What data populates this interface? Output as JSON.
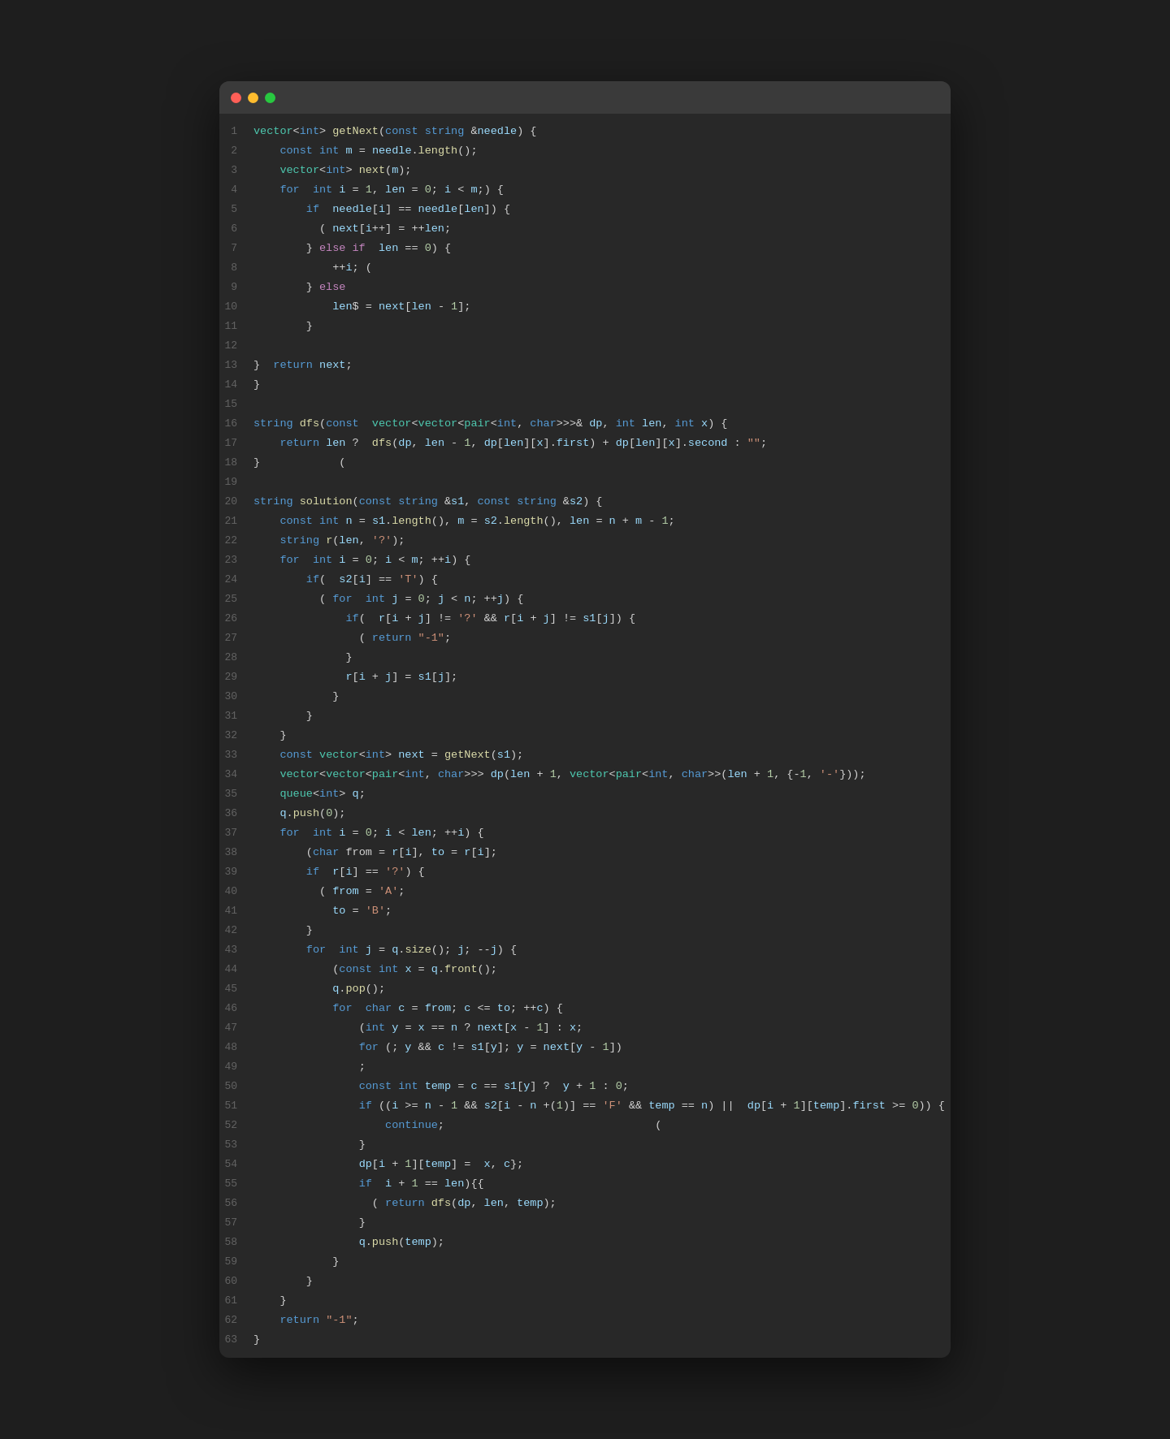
{
  "window": {
    "titlebar": {
      "dot_red": "close",
      "dot_yellow": "minimize",
      "dot_green": "maximize"
    }
  },
  "code": {
    "lines": [
      {
        "n": 1
      },
      {
        "n": 2
      },
      {
        "n": 3
      },
      {
        "n": 4
      },
      {
        "n": 5
      },
      {
        "n": 6
      },
      {
        "n": 7
      },
      {
        "n": 8
      },
      {
        "n": 9
      },
      {
        "n": 10
      },
      {
        "n": 11
      },
      {
        "n": 12
      },
      {
        "n": 13
      },
      {
        "n": 14
      },
      {
        "n": 15
      },
      {
        "n": 16
      },
      {
        "n": 17
      },
      {
        "n": 18
      },
      {
        "n": 19
      },
      {
        "n": 20
      },
      {
        "n": 21
      },
      {
        "n": 22
      },
      {
        "n": 23
      },
      {
        "n": 24
      },
      {
        "n": 25
      },
      {
        "n": 26
      },
      {
        "n": 27
      },
      {
        "n": 28
      },
      {
        "n": 29
      },
      {
        "n": 30
      },
      {
        "n": 31
      },
      {
        "n": 32
      },
      {
        "n": 33
      },
      {
        "n": 34
      },
      {
        "n": 35
      },
      {
        "n": 36
      },
      {
        "n": 37
      },
      {
        "n": 38
      },
      {
        "n": 39
      },
      {
        "n": 40
      },
      {
        "n": 41
      },
      {
        "n": 42
      },
      {
        "n": 43
      },
      {
        "n": 44
      },
      {
        "n": 45
      },
      {
        "n": 46
      },
      {
        "n": 47
      },
      {
        "n": 48
      },
      {
        "n": 49
      },
      {
        "n": 50
      },
      {
        "n": 51
      },
      {
        "n": 52
      },
      {
        "n": 53
      },
      {
        "n": 54
      },
      {
        "n": 55
      },
      {
        "n": 56
      },
      {
        "n": 57
      },
      {
        "n": 58
      },
      {
        "n": 59
      },
      {
        "n": 60
      },
      {
        "n": 61
      },
      {
        "n": 62
      },
      {
        "n": 63
      }
    ]
  }
}
